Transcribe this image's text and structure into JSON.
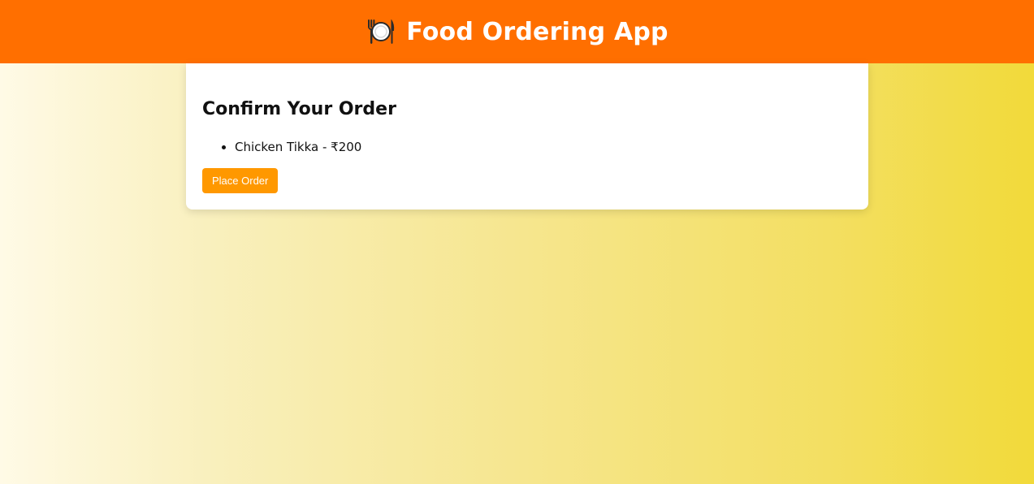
{
  "header": {
    "icon": "fork-knife-plate-icon",
    "title": "Food Ordering App",
    "background_color": "#ff6f00"
  },
  "order": {
    "heading": "Confirm Your Order",
    "items": [
      {
        "label": "Chicken Tikka - ₹200"
      }
    ],
    "place_order_label": "Place Order",
    "button_color": "#ff9800"
  }
}
